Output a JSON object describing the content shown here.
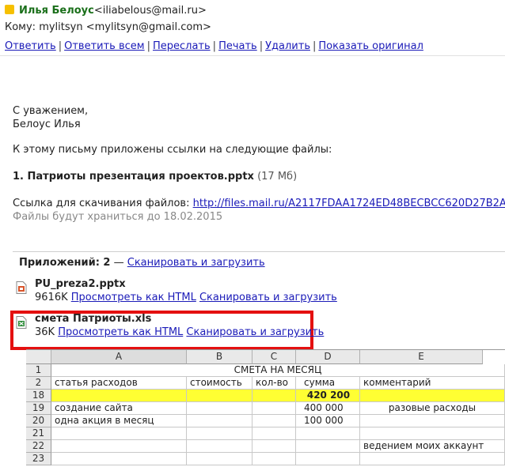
{
  "email": {
    "from_name": "Илья Белоус",
    "from_email": "<iliabelous@mail.ru>",
    "to_line": "Кому: mylitsyn <mylitsyn@gmail.com>",
    "actions": [
      "Ответить",
      "Ответить всем",
      "Переслать",
      "Печать",
      "Удалить",
      "Показать оригинал"
    ],
    "body_lines": [
      "С уважением,",
      "Белоус Илья"
    ],
    "intro": "К этому письму приложены ссылки на следующие файлы:",
    "file1_name": "1. Патриоты презентация проектов.pptx",
    "file1_size": "(17 Мб)",
    "download_label": "Ссылка для скачивания файлов:",
    "download_url": "http://files.mail.ru/A2117FDAA1724ED48BECBCC620D27B2A",
    "keep_until": "Файлы будут храниться до 18.02.2015"
  },
  "attachments": {
    "header": "Приложений: 2",
    "dash": " — ",
    "scan_all": "Сканировать и загрузить",
    "items": [
      {
        "name": "PU_preza2.pptx",
        "size": "9616K",
        "view": "Просмотреть как HTML",
        "scan": "Сканировать и загрузить"
      },
      {
        "name": "смета Патриоты.xls",
        "size": "36K",
        "view": "Просмотреть как HTML",
        "scan": "Сканировать и загрузить"
      }
    ]
  },
  "sheet": {
    "columns": [
      "A",
      "B",
      "C",
      "D",
      "E"
    ],
    "rows": [
      {
        "num": "1",
        "A": "",
        "B": "",
        "C": "",
        "D": "",
        "E": "",
        "merged": "СМЕТА НА МЕСЯЦ"
      },
      {
        "num": "2",
        "A": "статья расходов",
        "B": "стоимость",
        "C": "кол-во",
        "D": "сумма",
        "E": "комментарий"
      },
      {
        "num": "18",
        "A": "",
        "B": "",
        "C": "",
        "D": "420 200",
        "E": ""
      },
      {
        "num": "19",
        "A": "создание сайта",
        "B": "",
        "C": "",
        "D": "400 000",
        "E": "разовые расходы"
      },
      {
        "num": "20",
        "A": "одна акция в месяц",
        "B": "",
        "C": "",
        "D": "100 000",
        "E": ""
      },
      {
        "num": "21",
        "A": "",
        "B": "",
        "C": "",
        "D": "",
        "E": ""
      },
      {
        "num": "22",
        "A": "",
        "B": "",
        "C": "",
        "D": "",
        "E": "ведением моих аккаунт"
      },
      {
        "num": "23",
        "A": "",
        "B": "",
        "C": "",
        "D": "",
        "E": ""
      }
    ],
    "highlight_color": "#ffff33"
  },
  "colors": {
    "link": "#1a1ab8",
    "sender": "#1a6f1a",
    "highlight_border": "#e41010"
  }
}
